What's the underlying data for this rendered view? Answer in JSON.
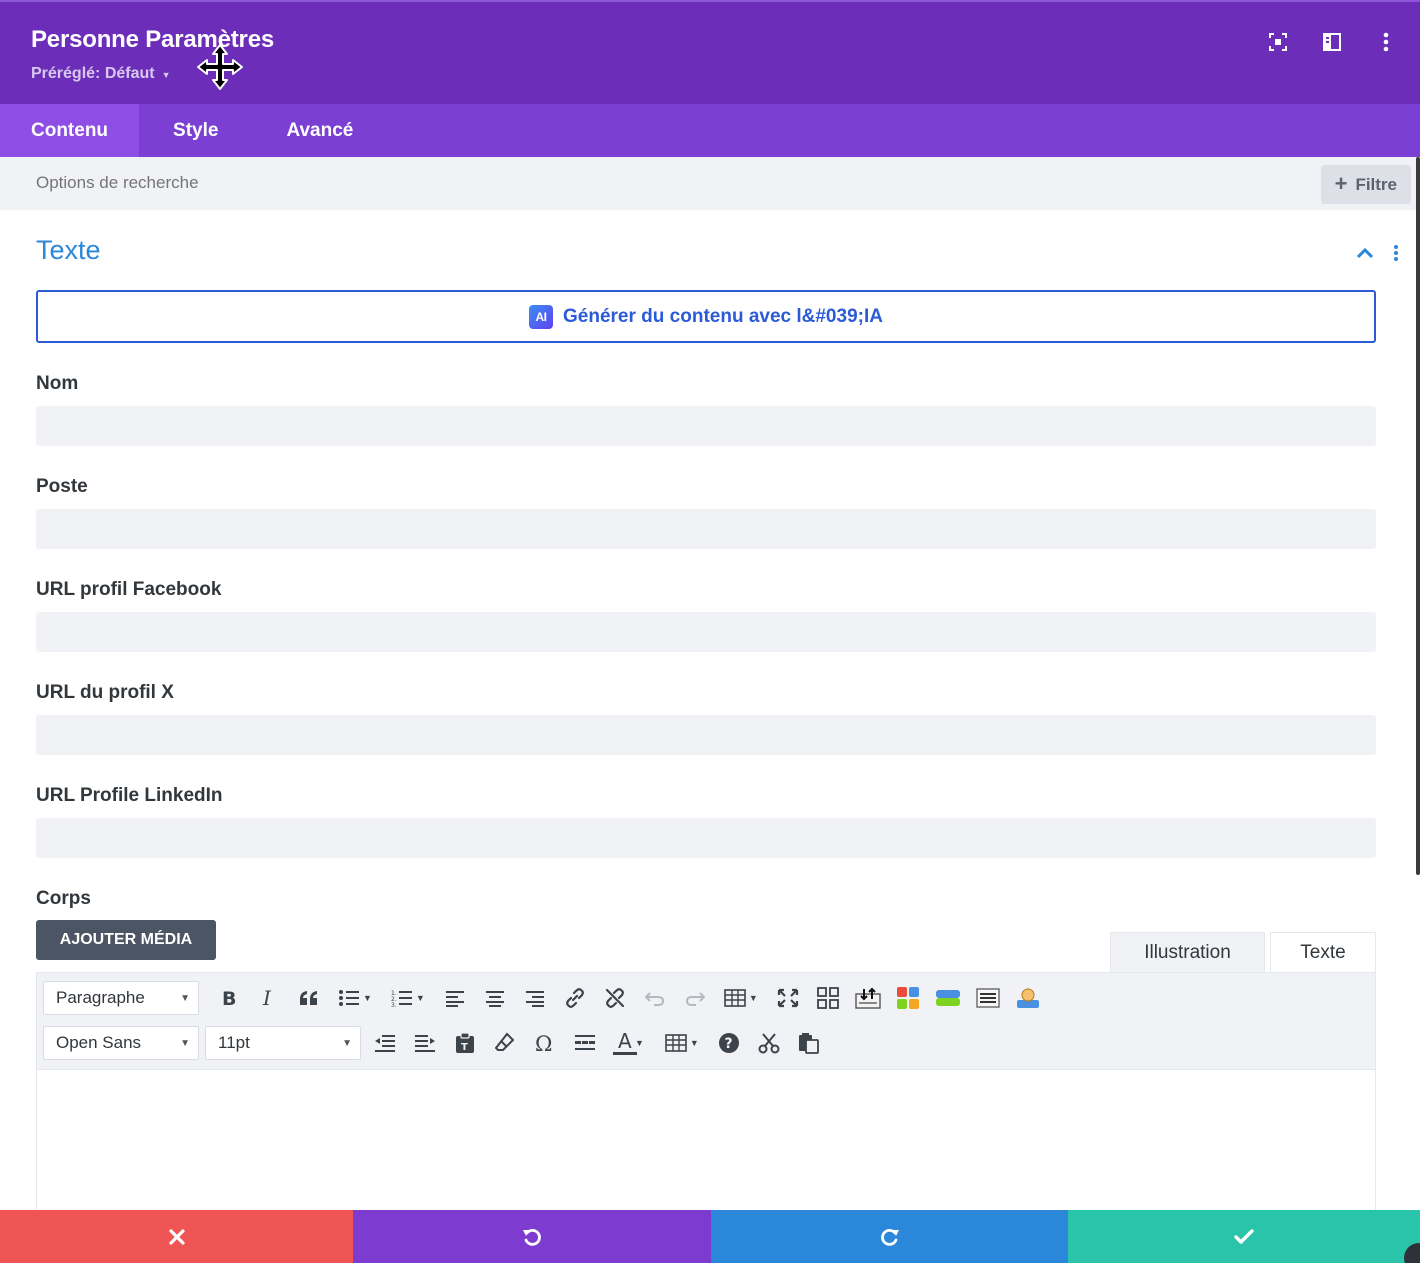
{
  "header": {
    "title": "Personne Paramètres",
    "preset_label": "Préréglé: Défaut",
    "icons": [
      "fullscreen-icon",
      "sidebar-toggle-icon",
      "more-vert-icon"
    ]
  },
  "tabs": [
    {
      "label": "Contenu",
      "active": true
    },
    {
      "label": "Style",
      "active": false
    },
    {
      "label": "Avancé",
      "active": false
    }
  ],
  "search": {
    "placeholder": "Options de recherche",
    "filter_label": "Filtre"
  },
  "section": {
    "title": "Texte",
    "ai_button_label": "Générer du contenu avec l&#039;IA",
    "ai_badge": "AI"
  },
  "fields": [
    {
      "label": "Nom",
      "value": ""
    },
    {
      "label": "Poste",
      "value": ""
    },
    {
      "label": "URL profil Facebook",
      "value": ""
    },
    {
      "label": "URL du profil X",
      "value": ""
    },
    {
      "label": "URL Profile LinkedIn",
      "value": ""
    }
  ],
  "body": {
    "label": "Corps",
    "add_media_label": "AJOUTER MÉDIA",
    "editor_tabs": [
      "Illustration",
      "Texte"
    ],
    "format_select": "Paragraphe",
    "font_select": "Open Sans",
    "size_select": "11pt"
  },
  "colors": {
    "header_bg": "#6c2eb9",
    "tabs_bg": "#7b3fd4",
    "accent_blue": "#2b87da",
    "cancel": "#ef5555",
    "undo": "#7e3bd0",
    "redo": "#2b87da",
    "save": "#29c4a9"
  }
}
